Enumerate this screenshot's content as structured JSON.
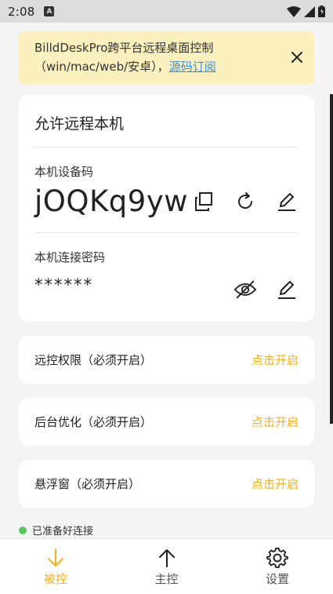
{
  "status_bar": {
    "time": "2:08",
    "notif_glyph": "A"
  },
  "banner": {
    "text": "BilldDeskPro跨平台远程桌面控制（win/mac/web/安卓），",
    "link": "源码订阅"
  },
  "main_card": {
    "title": "允许远程本机",
    "device_code_label": "本机设备码",
    "device_code": "jOQKq9yw",
    "password_label": "本机连接密码",
    "password": "******"
  },
  "permissions": [
    {
      "label": "远控权限（必须开启）",
      "action": "点击开启"
    },
    {
      "label": "后台优化（必须开启）",
      "action": "点击开启"
    },
    {
      "label": "悬浮窗（必须开启）",
      "action": "点击开启"
    }
  ],
  "connection_status": "已准备好连接",
  "nav": [
    {
      "label": "被控",
      "icon": "arrow-down-icon",
      "active": true
    },
    {
      "label": "主控",
      "icon": "arrow-up-icon",
      "active": false
    },
    {
      "label": "设置",
      "icon": "gear-icon",
      "active": false
    }
  ],
  "colors": {
    "accent": "#f5b11a",
    "banner_bg": "#fbf1be",
    "link": "#2f8df0",
    "status_ok": "#5cc65e"
  }
}
